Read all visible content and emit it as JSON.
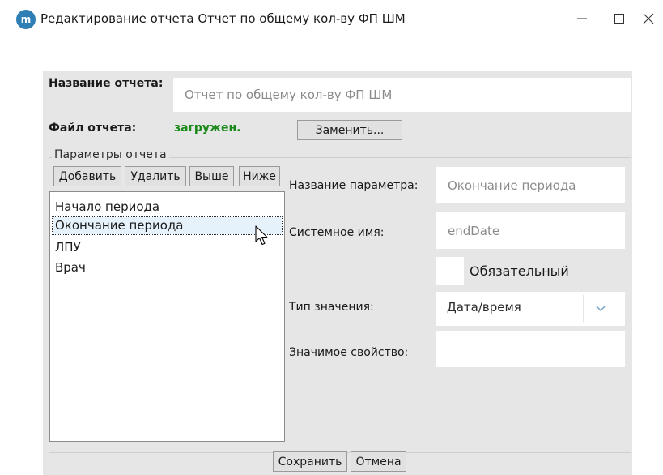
{
  "window": {
    "app_icon_letter": "m",
    "title": "Редактирование отчета Отчет по общему кол-ву ФП ШМ",
    "controls": [
      "minimize",
      "maximize",
      "close"
    ]
  },
  "report": {
    "name_label": "Название отчета:",
    "name_value": "Отчет по общему кол-ву ФП ШМ",
    "file_label": "Файл отчета:",
    "file_status": "загружен.",
    "replace_button": "Заменить..."
  },
  "params_group": {
    "legend": "Параметры отчета",
    "toolbar": {
      "add": "Добавить",
      "remove": "Удалить",
      "up": "Выше",
      "down": "Ниже"
    },
    "items": [
      "Начало периода",
      "Окончание периода",
      "ЛПУ",
      "Врач"
    ],
    "selected_index": 1
  },
  "param_form": {
    "name_label": "Название параметра:",
    "name_value": "Окончание периода",
    "system_label": "Системное имя:",
    "system_value": "endDate",
    "required_label": "Обязательный",
    "required_checked": false,
    "type_label": "Тип значения:",
    "type_value": "Дата/время",
    "property_label": "Значимое свойство:",
    "property_value": ""
  },
  "footer": {
    "save": "Сохранить",
    "cancel": "Отмена"
  },
  "colors": {
    "dialog_bg": "#e6e6e6",
    "status_green": "#1b8a1b",
    "selection_bg": "#e5f1fb",
    "app_icon": "#2f7fb5"
  }
}
